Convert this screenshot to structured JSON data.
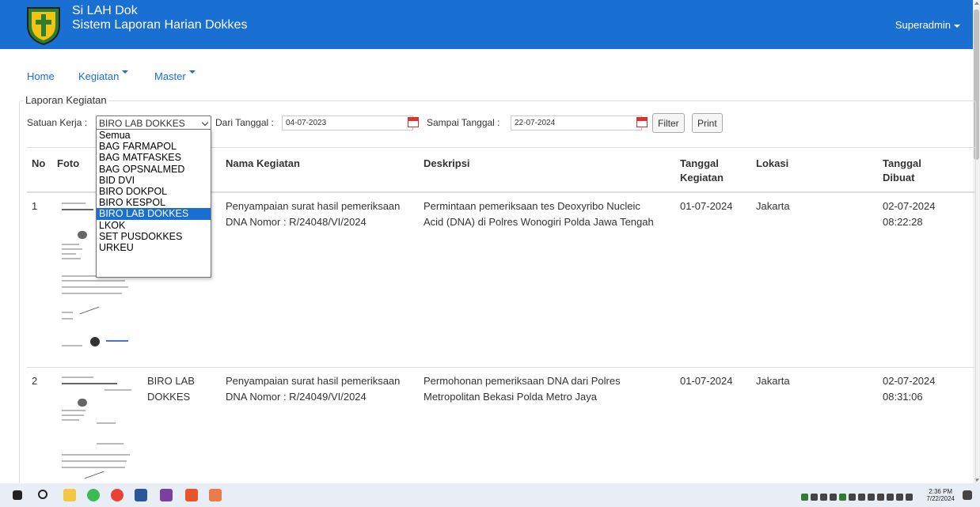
{
  "header": {
    "title_line1": "Si LAH Dok",
    "title_line2": "Sistem Laporan Harian Dokkes",
    "user": "Superadmin",
    "bg_color": "#1a6fd2"
  },
  "nav": {
    "home": "Home",
    "kegiatan": "Kegiatan",
    "master": "Master"
  },
  "panel": {
    "legend": "Laporan Kegiatan"
  },
  "filters": {
    "satuan_label": "Satuan Kerja :",
    "satuan_value": "BIRO LAB DOKKES",
    "dari_label": "Dari Tanggal :",
    "dari_value": "04-07-2023",
    "sampai_label": "Sampai Tanggal :",
    "sampai_value": "22-07-2024",
    "filter_button": "Filter",
    "print_button": "Print"
  },
  "dropdown": {
    "options": [
      "Semua",
      "BAG FARMAPOL",
      "BAG MATFASKES",
      "BAG OPSNALMED",
      "BID DVI",
      "BIRO DOKPOL",
      "BIRO KESPOL",
      "BIRO LAB DOKKES",
      "LKOK",
      "SET PUSDOKKES",
      "URKEU"
    ],
    "selected": "BIRO LAB DOKKES"
  },
  "table": {
    "headers": {
      "no": "No",
      "foto": "Foto",
      "nama": "Nama Kegiatan",
      "deskripsi": "Deskripsi",
      "tgl_kegiatan_1": "Tanggal",
      "tgl_kegiatan_2": "Kegiatan",
      "lokasi": "Lokasi",
      "tgl_dibuat_1": "Tanggal",
      "tgl_dibuat_2": "Dibuat"
    },
    "rows": [
      {
        "no": "1",
        "satuan_1": "",
        "satuan_2": "",
        "nama_1": "Penyampaian surat hasil pemeriksaan",
        "nama_2": "DNA Nomor : R/24048/VI/2024",
        "desk_1": "Permintaan pemeriksaan tes Deoxyribo Nucleic",
        "desk_2": "Acid (DNA) di Polres Wonogiri Polda Jawa Tengah",
        "tgl_kegiatan": "01-07-2024",
        "lokasi": "Jakarta",
        "dibuat_date": "02-07-2024",
        "dibuat_time": "08:22:28"
      },
      {
        "no": "2",
        "satuan_1": "BIRO LAB",
        "satuan_2": "DOKKES",
        "nama_1": "Penyampaian surat hasil pemeriksaan",
        "nama_2": "DNA Nomor : R/24049/VI/2024",
        "desk_1": "Permohonan pemeriksaan DNA dari Polres",
        "desk_2": "Metropolitan Bekasi Polda Metro Jaya",
        "tgl_kegiatan": "01-07-2024",
        "lokasi": "Jakarta",
        "dibuat_date": "02-07-2024",
        "dibuat_time": "08:31:06"
      }
    ]
  },
  "taskbar": {
    "time": "2:36 PM",
    "date": "7/22/2024"
  }
}
